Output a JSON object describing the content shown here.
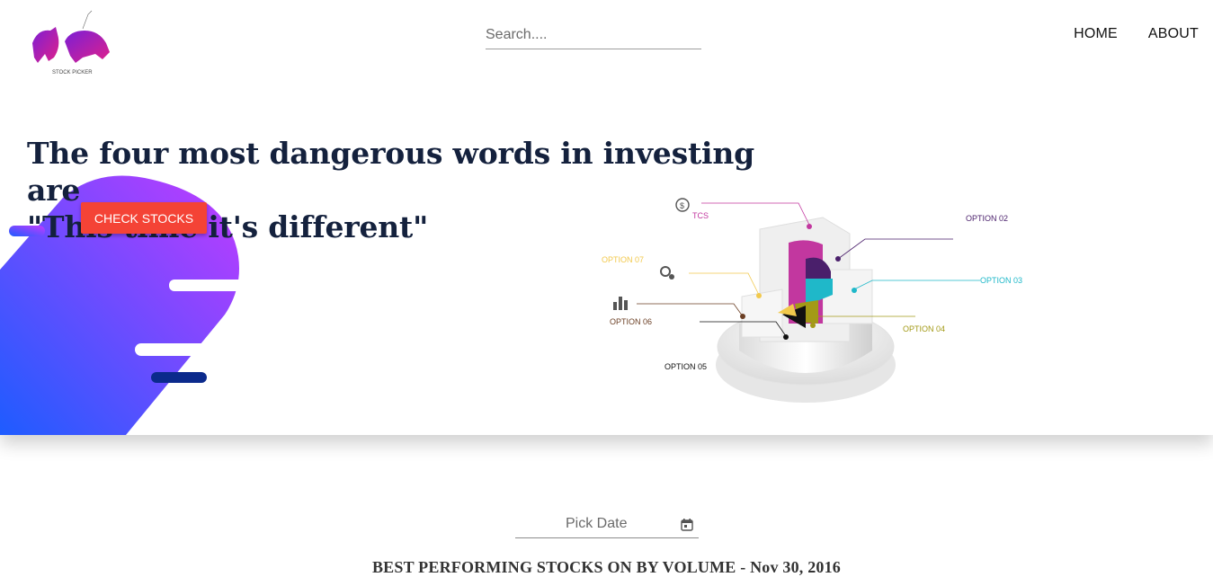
{
  "header": {
    "logo_text": "STOCK PICKER",
    "search_placeholder": "Search....",
    "nav": {
      "home": "HOME",
      "about": "ABOUT"
    }
  },
  "hero": {
    "quote_line1": "The four most dangerous words in investing are",
    "quote_line2": "\"This time it's different\"",
    "cta_label": "CHECK STOCKS"
  },
  "infographic": {
    "labels": {
      "tcs": "TCS",
      "opt02": "OPTION 02",
      "opt03": "OPTION 03",
      "opt04": "OPTION 04",
      "opt05": "OPTION 05",
      "opt06": "OPTION 06",
      "opt07": "OPTION 07"
    },
    "colors": {
      "tcs": "#c2379f",
      "opt02": "#4a1f6b",
      "opt03": "#1fb8c9",
      "opt04": "#a39a17",
      "opt05": "#111111",
      "opt06": "#6b3f24",
      "opt07": "#f2c94c"
    }
  },
  "date_picker": {
    "label": "Pick Date",
    "icon": "calendar-icon"
  },
  "section": {
    "title": "BEST PERFORMING STOCKS ON BY VOLUME - Nov 30, 2016"
  },
  "theme": {
    "accent": "#f44336",
    "heading": "#14213d",
    "blob_from": "#b23cff",
    "blob_to": "#1f5bff"
  }
}
